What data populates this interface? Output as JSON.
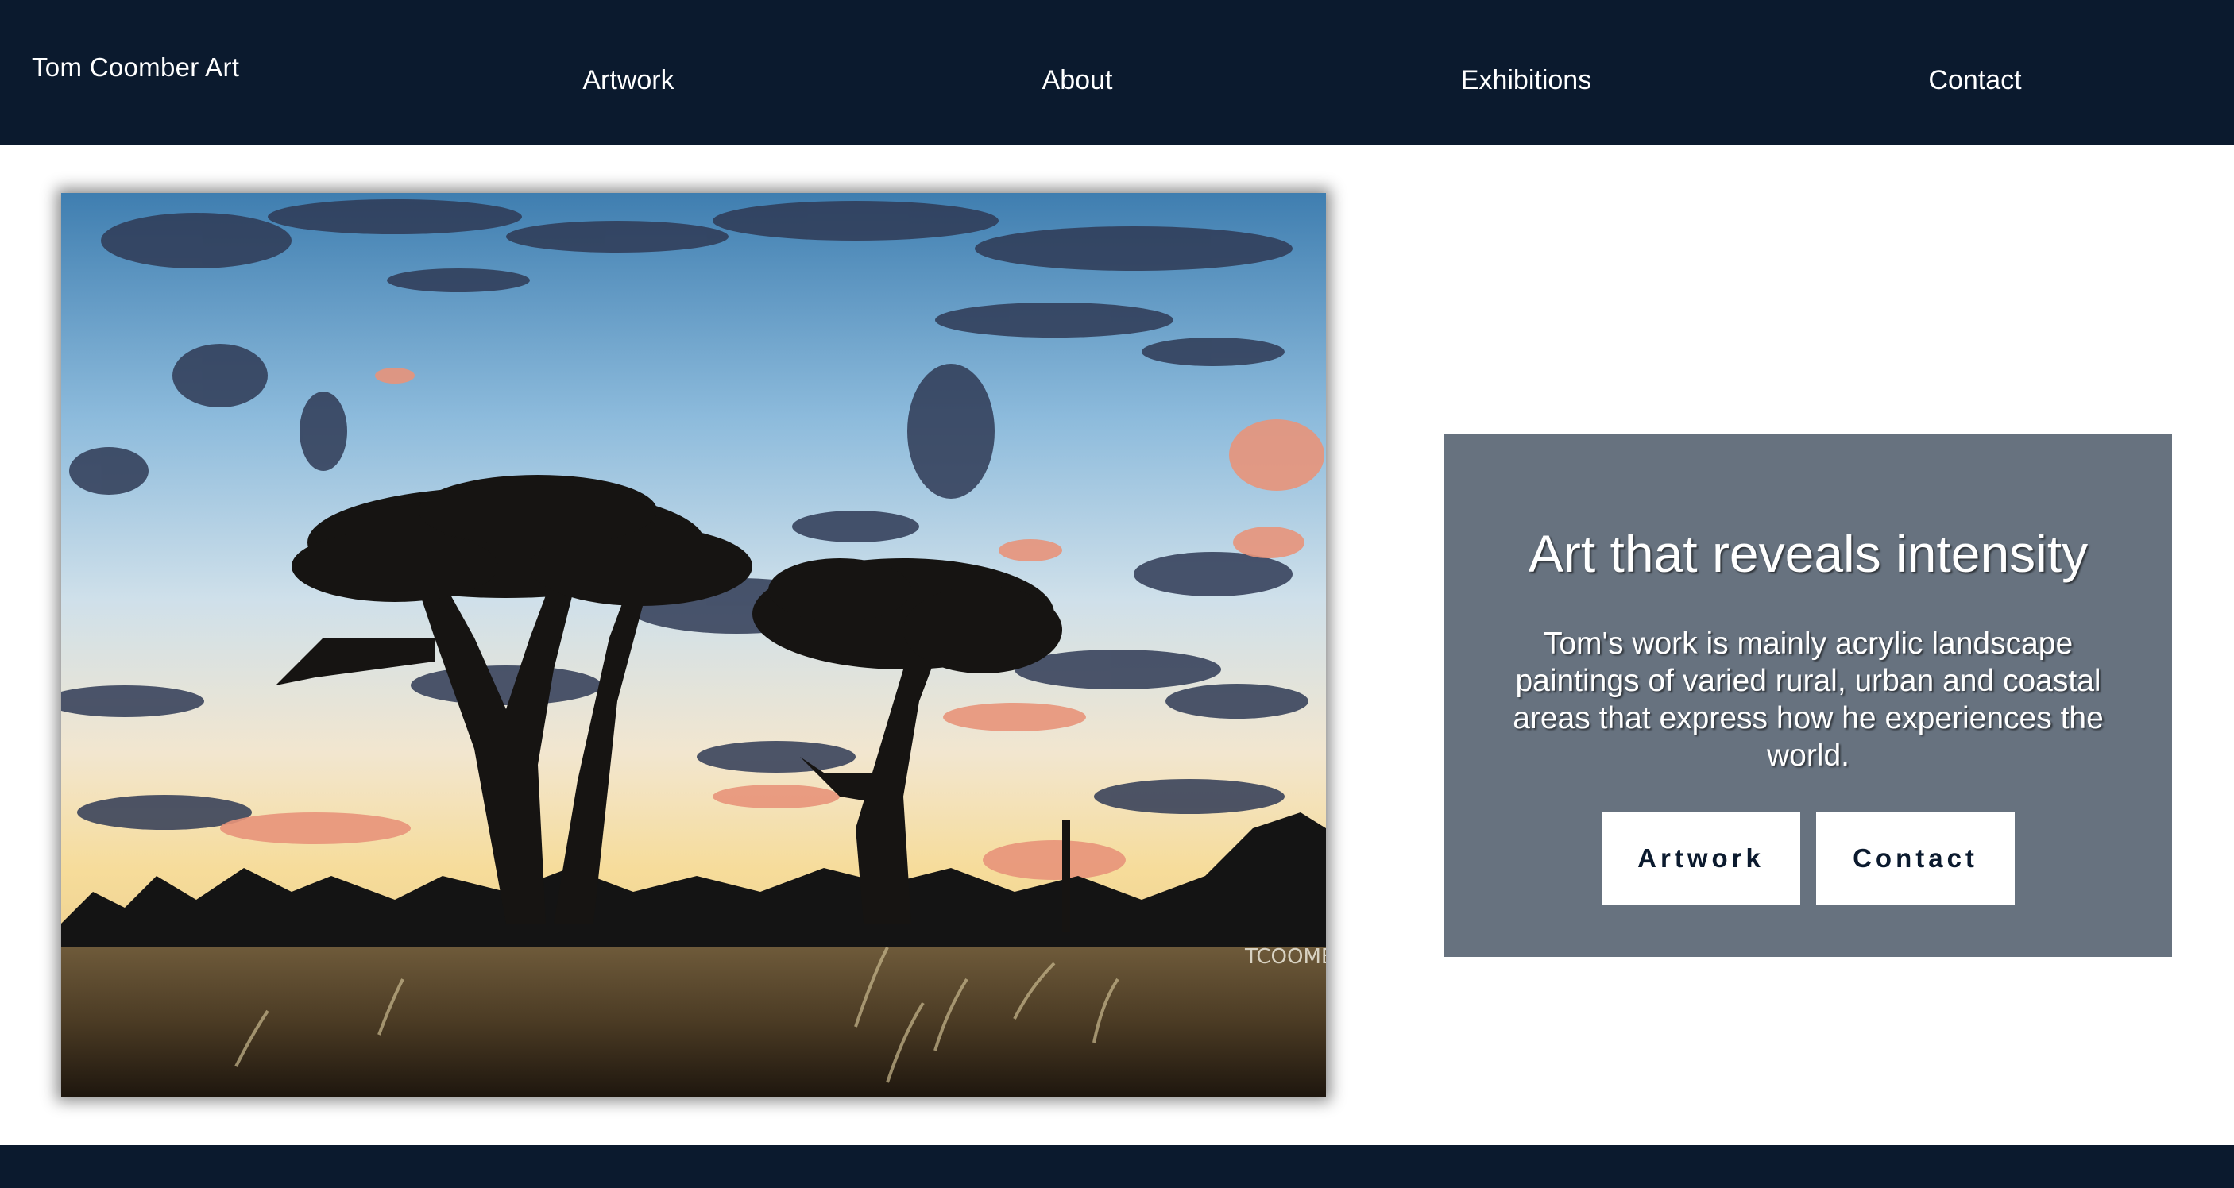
{
  "header": {
    "logo": "Tom Coomber Art",
    "nav": [
      "Artwork",
      "About",
      "Exhibitions",
      "Contact"
    ]
  },
  "hero": {
    "image_alt": "Acrylic painting of silhouetted trees against a sunset sky",
    "signature": "TCOOMBER"
  },
  "info": {
    "title": "Art that reveals intensity",
    "description": "Tom's work is mainly acrylic landscape paintings of varied rural, urban and coastal areas that express how he experiences the world.",
    "buttons": [
      "Artwork",
      "Contact"
    ]
  },
  "colors": {
    "navy": "#0b1a2e",
    "panel": "#67727f",
    "white": "#ffffff"
  }
}
